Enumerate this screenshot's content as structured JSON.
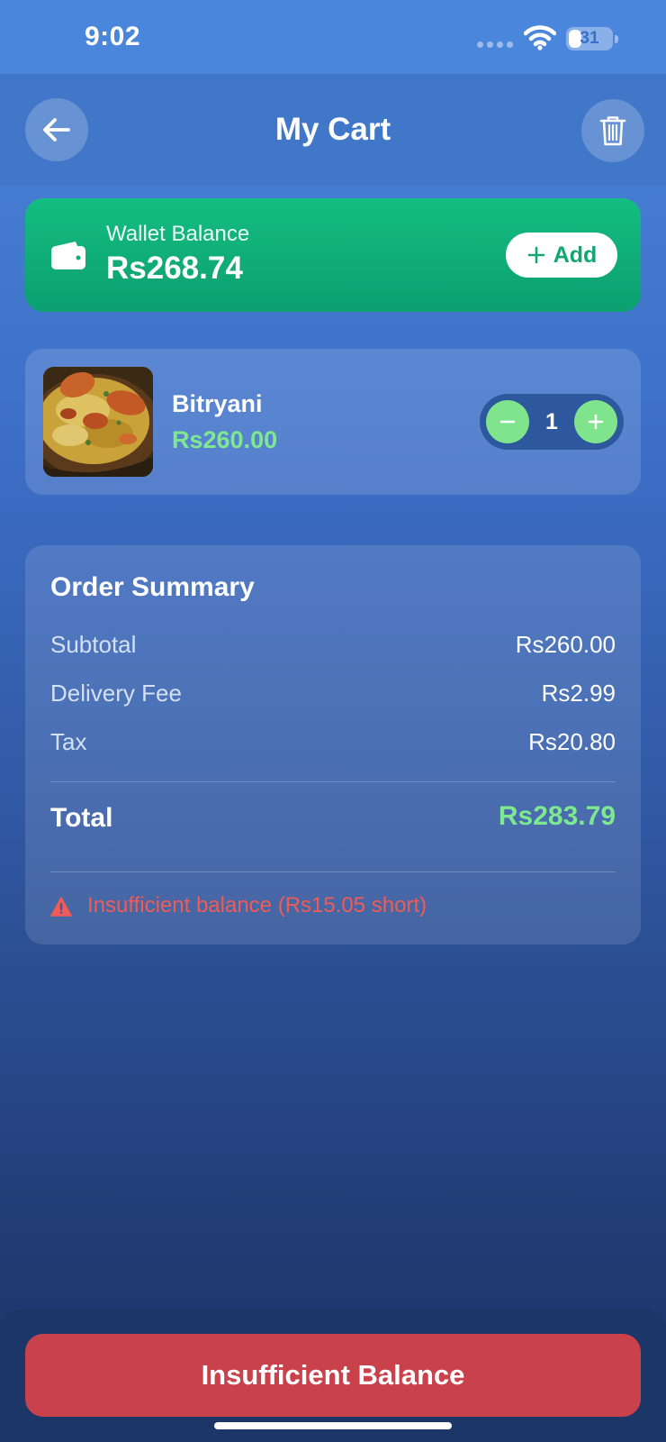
{
  "status_bar": {
    "time": "9:02",
    "battery_level": "31",
    "battery_fraction": 0.31
  },
  "header": {
    "title": "My Cart",
    "back_icon": "arrow-left-icon",
    "trash_icon": "trash-icon"
  },
  "wallet": {
    "label": "Wallet Balance",
    "amount": "Rs268.74",
    "add_label": "Add",
    "icon": "wallet-icon"
  },
  "cart": {
    "items": [
      {
        "name": "Bitryani",
        "price": "Rs260.00",
        "quantity": "1"
      }
    ]
  },
  "summary": {
    "title": "Order Summary",
    "rows": [
      {
        "label": "Subtotal",
        "value": "Rs260.00"
      },
      {
        "label": "Delivery Fee",
        "value": "Rs2.99"
      },
      {
        "label": "Tax",
        "value": "Rs20.80"
      }
    ],
    "total_label": "Total",
    "total_value": "Rs283.79",
    "warning": "Insufficient balance (Rs15.05 short)"
  },
  "checkout": {
    "label": "Insufficient Balance"
  },
  "colors": {
    "accent_green": "#7ee890",
    "wallet_green": "#14bd82",
    "warning_red": "#f25b55",
    "button_red": "#c8414b"
  }
}
